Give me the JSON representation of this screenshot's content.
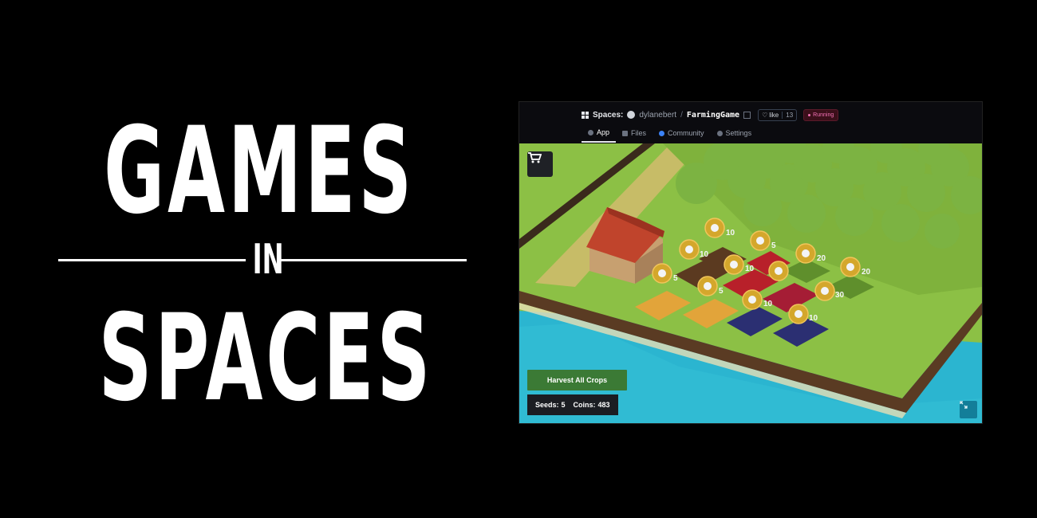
{
  "hero": {
    "line1": "GAMES",
    "line2": "IN",
    "line3": "SPACES"
  },
  "header": {
    "spaces_label": "Spaces:",
    "owner": "dylanebert",
    "separator": "/",
    "repo": "FarmingGame",
    "like_label": "like",
    "like_count": "13",
    "status": "Running"
  },
  "tabs": [
    {
      "label": "App",
      "active": true
    },
    {
      "label": "Files",
      "active": false
    },
    {
      "label": "Community",
      "active": false
    },
    {
      "label": "Settings",
      "active": false
    }
  ],
  "game": {
    "harvest_label": "Harvest All Crops",
    "seeds_label": "Seeds:",
    "seeds_value": "5",
    "coins_label": "Coins:",
    "coins_value": "483",
    "plot_values": [
      "10",
      "5",
      "10",
      "10",
      "20",
      "20",
      "5",
      "5",
      "10",
      "30",
      "10",
      "10"
    ]
  },
  "icons": {
    "cart": "shopping-cart-icon",
    "expand": "expand-icon",
    "coin": "coin-icon"
  },
  "colors": {
    "grass": "#8cc045",
    "water": "#2bb5d0",
    "barn_roof": "#c0442c",
    "harvest_button": "#3b7a35",
    "status_badge": "#f472b6"
  }
}
